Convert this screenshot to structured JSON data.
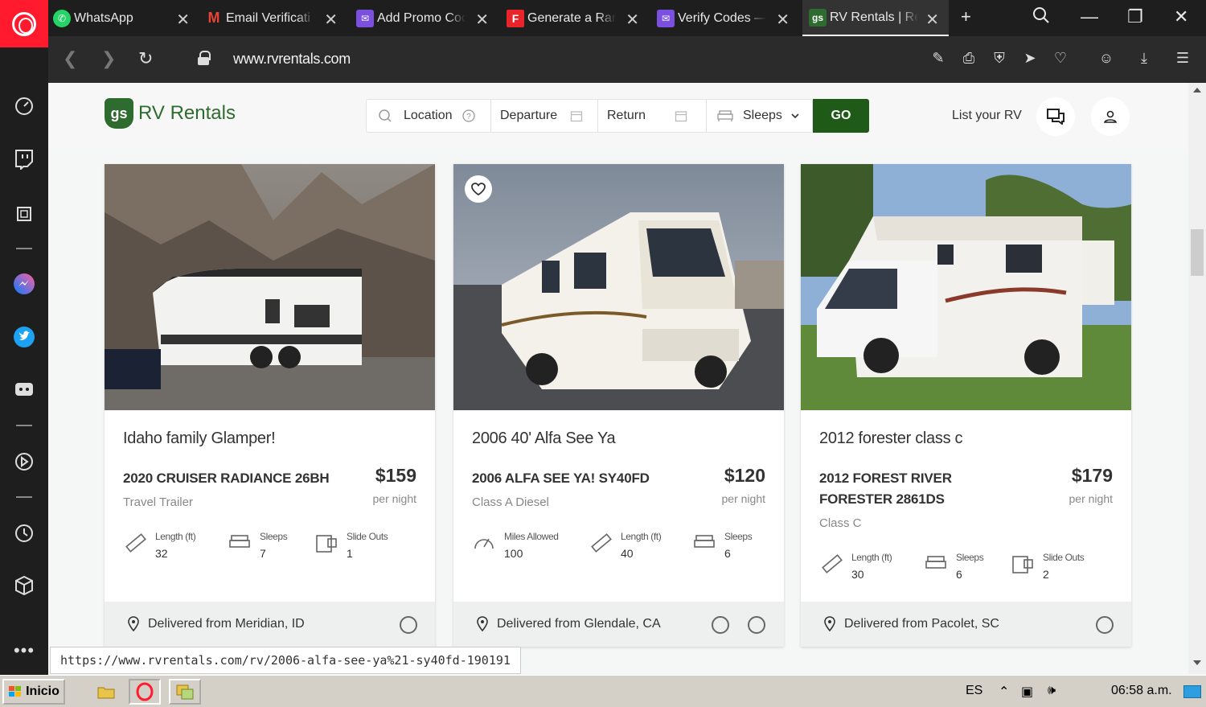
{
  "browser": {
    "tabs": [
      {
        "label": "WhatsApp",
        "icon": "whatsapp-icon"
      },
      {
        "label": "Email Verificati",
        "icon": "gmail-icon"
      },
      {
        "label": "Add Promo Coc",
        "icon": "mail-icon"
      },
      {
        "label": "Generate a Ran",
        "icon": "f-icon"
      },
      {
        "label": "Verify Codes —",
        "icon": "mail-icon"
      },
      {
        "label": "RV Rentals | Re",
        "icon": "gs-icon",
        "active": true
      }
    ],
    "url": "www.rvrentals.com",
    "status_link": "https://www.rvrentals.com/rv/2006-alfa-see-ya%21-sy40fd-190191"
  },
  "site": {
    "brand_badge": "gs",
    "brand": "RV Rentals",
    "search": {
      "location": "Location",
      "departure": "Departure",
      "return": "Return",
      "sleeps": "Sleeps",
      "go": "GO"
    },
    "list_your_rv": "List your RV"
  },
  "listings": [
    {
      "title": "Idaho family Glamper!",
      "model": "2020 CRUISER RADIANCE 26BH",
      "type": "Travel Trailer",
      "price": "$159",
      "per_night": "per night",
      "specs": [
        {
          "label": "Length (ft)",
          "value": "32"
        },
        {
          "label": "Sleeps",
          "value": "7"
        },
        {
          "label": "Slide Outs",
          "value": "1"
        }
      ],
      "location": "Delivered from Meridian, ID"
    },
    {
      "title": "2006 40' Alfa See Ya",
      "model": "2006 ALFA SEE YA! SY40FD",
      "type": "Class A Diesel",
      "price": "$120",
      "per_night": "per night",
      "specs": [
        {
          "label": "Miles Allowed",
          "value": "100"
        },
        {
          "label": "Length (ft)",
          "value": "40"
        },
        {
          "label": "Sleeps",
          "value": "6"
        }
      ],
      "location": "Delivered from Glendale, CA"
    },
    {
      "title": "2012 forester class c",
      "model": "2012 FOREST RIVER FORESTER 2861DS",
      "type": "Class C",
      "price": "$179",
      "per_night": "per night",
      "specs": [
        {
          "label": "Length (ft)",
          "value": "30"
        },
        {
          "label": "Sleeps",
          "value": "6"
        },
        {
          "label": "Slide Outs",
          "value": "2"
        }
      ],
      "location": "Delivered from Pacolet, SC"
    }
  ],
  "taskbar": {
    "start": "Inicio",
    "lang": "ES",
    "time": "06:58 a.m."
  },
  "colors": {
    "brand_green": "#2e6b2e",
    "go_green": "#1f5a18",
    "opera_red": "#ff1b2d"
  }
}
